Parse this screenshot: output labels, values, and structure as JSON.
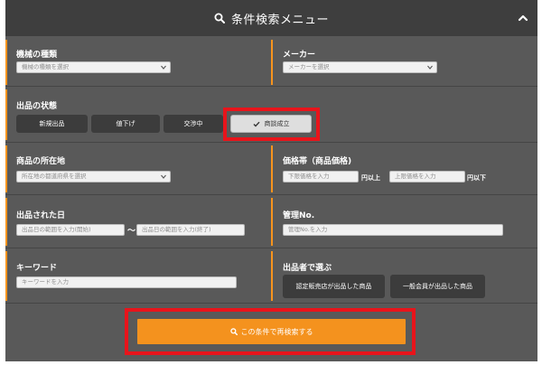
{
  "header": {
    "title": "条件検索メニュー"
  },
  "machine_type": {
    "label": "機械の種類",
    "placeholder": "機械の種類を選択"
  },
  "maker": {
    "label": "メーカー",
    "placeholder": "メーカーを選択"
  },
  "listing_status": {
    "label": "出品の状態",
    "options": [
      "新規出品",
      "値下げ",
      "交渉中",
      "商談成立"
    ],
    "selected": "商談成立"
  },
  "location": {
    "label": "商品の所在地",
    "placeholder": "所在地の都道府県を選択"
  },
  "price_range": {
    "label": "価格帯（商品価格)",
    "min_placeholder": "下限価格を入力",
    "min_unit": "円以上",
    "max_placeholder": "上限価格を入力",
    "max_unit": "円以下"
  },
  "listed_date": {
    "label": "出品された日",
    "from_placeholder": "出品日の範囲を入力(開始)",
    "separator": "〜",
    "to_placeholder": "出品日の範囲を入力(終了)"
  },
  "management_no": {
    "label": "管理No.",
    "placeholder": "管理No.を入力"
  },
  "keyword": {
    "label": "キーワード",
    "placeholder": "キーワードを入力"
  },
  "seller": {
    "label": "出品者で選ぶ",
    "options": [
      "認定販売店が出品した商品",
      "一般会員が出品した商品"
    ]
  },
  "search_button": {
    "label": "この条件で再検索する"
  },
  "colors": {
    "accent": "#f7941d",
    "panel": "#595959",
    "header": "#3e3e3e",
    "highlight": "#e8141b"
  }
}
